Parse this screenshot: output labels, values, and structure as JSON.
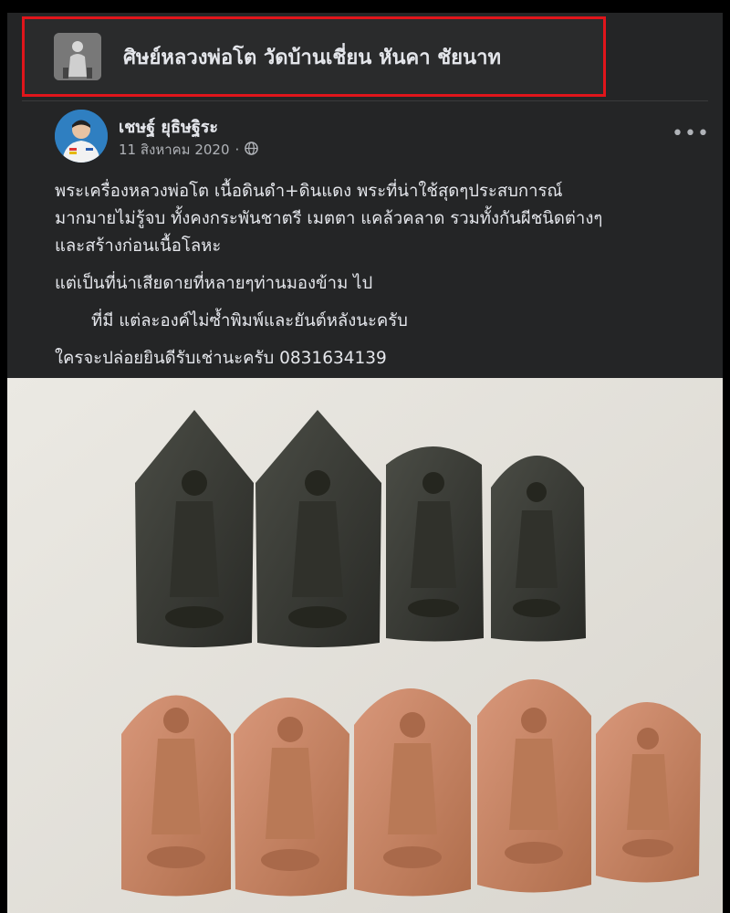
{
  "group": {
    "name": "ศิษย์หลวงพ่อโต วัดบ้านเชี่ยน หันคา ชัยนาท",
    "thumbnail_icon": "group-photo-icon"
  },
  "post": {
    "author": "เชษฐ์ ยุธิษฐิระ",
    "date": "11 สิงหาคม 2020",
    "privacy_icon": "globe-icon",
    "more_label": "•••",
    "lines": [
      "พระเครื่องหลวงพ่อโต เนื้อดินดำ+ดินแดง พระที่น่าใช้สุดๆประสบการณ์",
      "มากมายไม่รู้จบ ทั้งคงกระพันชาตรี เมตตา แคล้วคลาด รวมทั้งกันผีชนิดต่างๆ",
      "และสร้างก่อนเนื้อโลหะ",
      "แต่เป็นที่น่าเสียดายที่หลายๆท่านมองข้าม ไป",
      "ที่มี แต่ละองค์ไม่ซ้ำพิมพ์และยันต์หลังนะครับ",
      "ใครจะปล่อยยินดีรับเช่านะครับ 0831634139"
    ]
  },
  "colors": {
    "highlight_border": "#e0151b",
    "dark_amulet": "#3a3b36",
    "red_amulet": "#c7825f",
    "background_paper": "#e4e1da"
  }
}
